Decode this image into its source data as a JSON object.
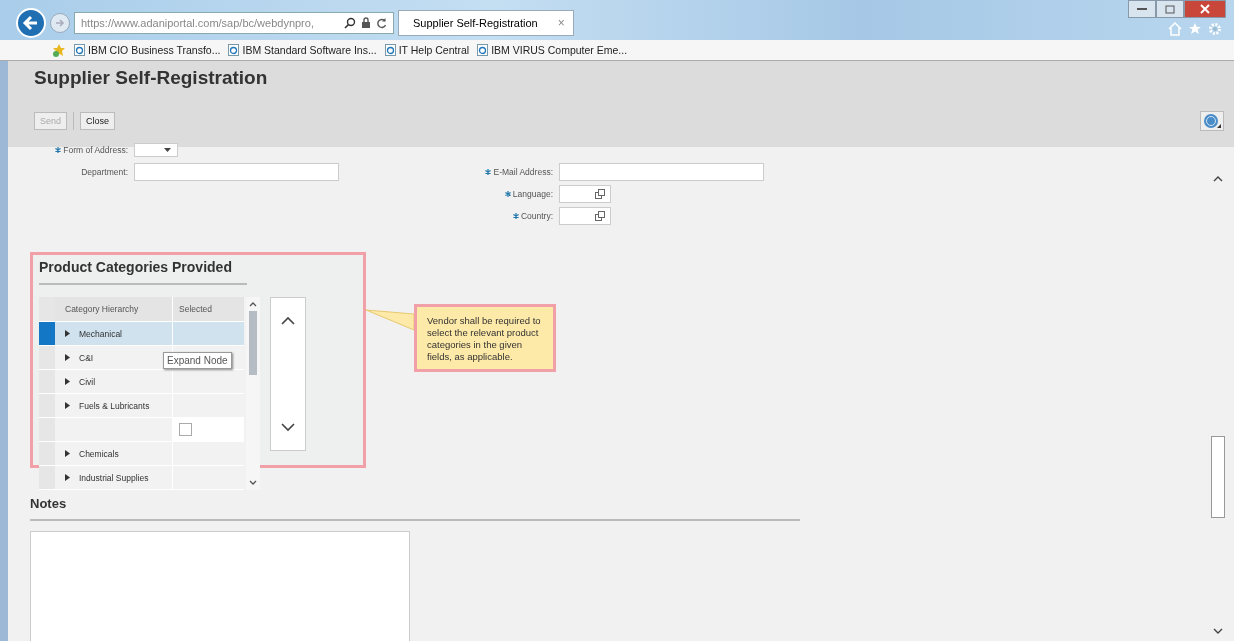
{
  "browser": {
    "address": "https://www.adaniportal.com/sap/bc/webdynpro,",
    "tab": {
      "title": "Supplier Self-Registration",
      "close": "×",
      "selected": true
    },
    "favorites": [
      "IBM CIO Business Transfo...",
      "IBM Standard Software Ins...",
      "IT Help Central",
      "IBM VIRUS Computer Eme..."
    ]
  },
  "page": {
    "title": "Supplier Self-Registration",
    "buttons": [
      {
        "label": "Send",
        "disabled": true
      },
      {
        "label": "Close",
        "disabled": false
      }
    ]
  },
  "form": {
    "left": [
      {
        "label": "Form of Address:",
        "required": true,
        "kind": "dropdown"
      },
      {
        "label": "Department:",
        "required": false,
        "kind": "text"
      }
    ],
    "right": [
      {
        "label": "E-Mail Address:",
        "required": true,
        "kind": "text"
      },
      {
        "label": "Language:",
        "required": true,
        "kind": "lookup"
      },
      {
        "label": "Country:",
        "required": true,
        "kind": "lookup"
      }
    ]
  },
  "product_categories": {
    "title": "Product Categories Provided",
    "columns": [
      "Category Hierarchy",
      "Selected"
    ],
    "rows": [
      {
        "category": "Mechanical",
        "kind": "node",
        "selected": true
      },
      {
        "category": "C&I",
        "kind": "node",
        "selected": false
      },
      {
        "category": "Civil",
        "kind": "node",
        "selected": false
      },
      {
        "category": "Fuels & Lubricants",
        "kind": "node",
        "selected": false
      },
      {
        "category": "",
        "kind": "checkbox",
        "checked": false,
        "selected": false
      },
      {
        "category": "Chemicals",
        "kind": "node",
        "selected": false
      },
      {
        "category": "Industrial Supplies",
        "kind": "node",
        "selected": false
      }
    ],
    "tooltip": "Expand Node"
  },
  "callout": "Vendor shall be required to select the relevant product categories in the given fields, as applicable.",
  "notes": {
    "title": "Notes"
  }
}
